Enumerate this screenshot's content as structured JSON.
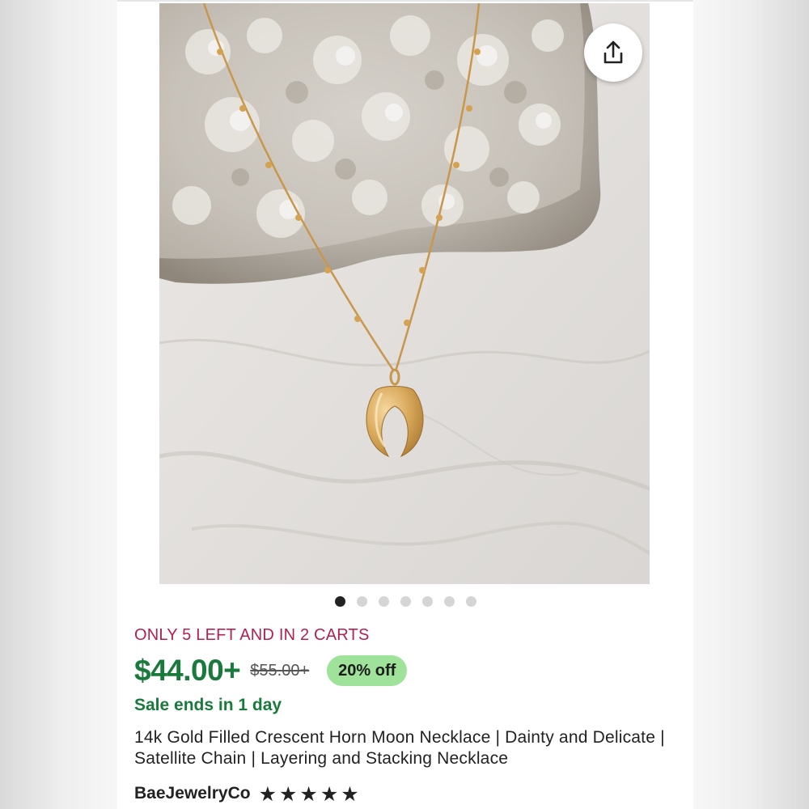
{
  "listing": {
    "stock_notice": "ONLY 5 LEFT AND IN 2 CARTS",
    "price": "$44.00+",
    "original_price": "$55.00+",
    "discount_badge": "20% off",
    "sale_ends": "Sale ends in 1 day",
    "title": "14k Gold Filled Crescent Horn Moon Necklace | Dainty and Delicate | Satellite Chain | Layering and Stacking Necklace",
    "shop_name": "BaeJewelryCo",
    "rating_stars": 5,
    "star_glyph": "★"
  },
  "gallery": {
    "image_count": 7,
    "active_index": 0
  },
  "icons": {
    "share": "share-icon",
    "favorite": "heart-icon"
  },
  "colors": {
    "stock_notice": "#b4204f",
    "price": "#1a7a3c",
    "sale_ends": "#1a7a3c",
    "discount_bg": "#9fe29a",
    "dot_active": "#222222",
    "dot_inactive": "#d5d5d5"
  }
}
